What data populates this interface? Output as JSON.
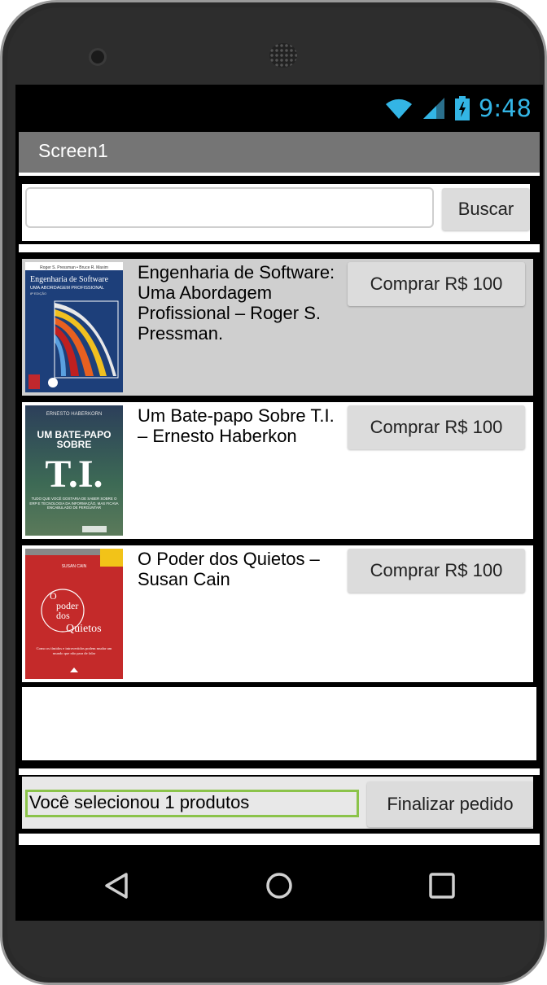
{
  "status_bar": {
    "time": "9:48"
  },
  "app_bar": {
    "title": "Screen1"
  },
  "search": {
    "value": "",
    "placeholder": "",
    "button_label": "Buscar"
  },
  "products": [
    {
      "title": "Engenharia de Software: Uma Abordagem Profissional – Roger S. Pressman.",
      "buy_label": "Comprar R$ 100",
      "selected": true,
      "cover": {
        "authors": "Roger S. Pressman • Bruce R. Maxim",
        "title": "Engenharia de Software",
        "subtitle": "UMA ABORDAGEM PROFISSIONAL",
        "edition": "8ª EDIÇÃO",
        "color": "#1d3f7a"
      }
    },
    {
      "title": "Um Bate-papo Sobre T.I. – Ernesto Haberkon",
      "buy_label": "Comprar R$ 100",
      "selected": false,
      "cover": {
        "author": "ERNESTO HABERKORN",
        "title_line1": "UM BATE-PAPO",
        "title_line2": "SOBRE",
        "title_line3": "T.I.",
        "tagline": "TUDO QUE VOCÊ GOSTARIA DE SABER SOBRE O ERP E TECNOLOGIA DA INFORMAÇÃO, MAS FICAVA ENCABULADO DE PERGUNTAR",
        "color": "#3f5a4a"
      }
    },
    {
      "title": "O Poder dos Quietos – Susan Cain",
      "buy_label": "Comprar R$ 100",
      "selected": false,
      "cover": {
        "author": "SUSAN CAIN",
        "title_line1": "O",
        "title_line2": "poder",
        "title_line3": "dos",
        "title_line4": "Quietos",
        "blurb": "Como os tímidos e introvertidos podem mudar um mundo que não para de falar",
        "color": "#c42a2a"
      }
    }
  ],
  "footer": {
    "status_text": "Você selecionou 1 produtos",
    "finish_label": "Finalizar pedido"
  }
}
